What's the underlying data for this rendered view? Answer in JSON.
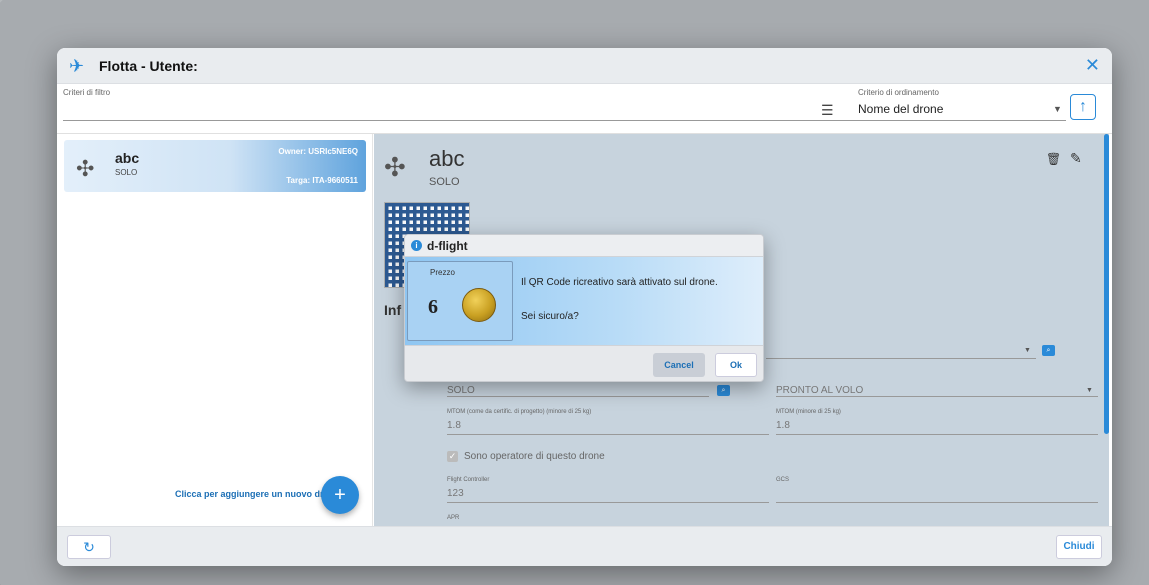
{
  "window": {
    "title": "Flotta - Utente:",
    "close_icon": "✕",
    "app_icon": "✈"
  },
  "filter": {
    "label": "Criteri di filtro",
    "icon": "filter-icon"
  },
  "sort": {
    "label": "Criterio di ordinamento",
    "value": "Nome del drone",
    "direction_icon": "↑"
  },
  "drone_list": {
    "items": [
      {
        "name": "abc",
        "model": "SOLO",
        "owner": "Owner: USRIc5NE6Q",
        "targa": "Targa: ITA-9660511"
      }
    ],
    "add_hint": "Clicca per aggiungere un nuovo drone.",
    "add_button": "+"
  },
  "detail": {
    "name": "abc",
    "model": "SOLO",
    "info_title": "Inf",
    "fields": {
      "modello_value": "SOLO",
      "stato_value": "PRONTO AL VOLO",
      "mtom_cert_label": "MTOM (come da certific. di progetto) (minore di 25 kg)",
      "mtom_cert_value": "1.8",
      "mtom_label": "MTOM (minore di 25 kg)",
      "mtom_value": "1.8",
      "operator_label": "Sono operatore di questo drone",
      "fc_label": "Flight Controller",
      "fc_value": "123",
      "gcs_label": "GCS",
      "apr_label": "APR"
    }
  },
  "footer": {
    "refresh_icon": "↻",
    "close_label": "Chiudi"
  },
  "dialog": {
    "title": "d-flight",
    "price_label": "Prezzo",
    "price_value": "6",
    "message": "Il QR Code ricreativo sarà attivato sul drone.",
    "question": "Sei sicuro/a?",
    "cancel_label": "Cancel",
    "ok_label": "Ok"
  }
}
